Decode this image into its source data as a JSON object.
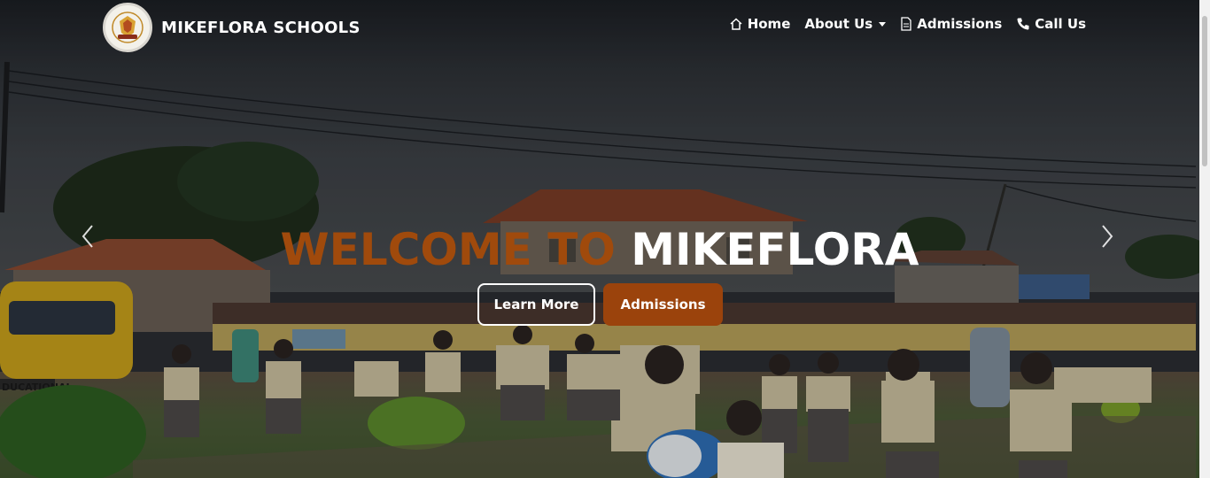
{
  "brand": {
    "name": "MIKEFLORA SCHOOLS"
  },
  "nav": {
    "home": "Home",
    "about": "About Us",
    "admissions": "Admissions",
    "call": "Call Us"
  },
  "hero": {
    "headline_part1": "WELCOME TO",
    "headline_part2": "MIKEFLORA",
    "learn_more_label": "Learn More",
    "admissions_label": "Admissions"
  },
  "scene": {
    "bus_text": "DUCATIONAL"
  },
  "colors": {
    "accent": "#9b430c",
    "headline_orange": "#a04a0c",
    "text": "#ffffff"
  },
  "icons": {
    "home": "home-icon",
    "about_dropdown": "chevron-down-icon",
    "admissions": "document-icon",
    "call": "phone-icon",
    "prev": "chevron-left-icon",
    "next": "chevron-right-icon"
  }
}
